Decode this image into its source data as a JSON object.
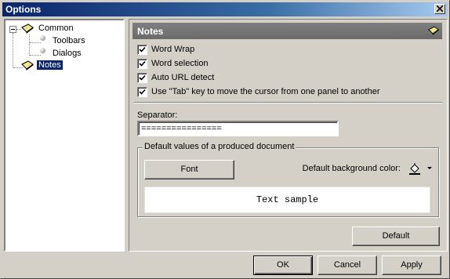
{
  "window": {
    "title": "Options"
  },
  "tree": {
    "items": [
      {
        "label": "Common"
      },
      {
        "label": "Toolbars"
      },
      {
        "label": "Dialogs"
      },
      {
        "label": "Notes",
        "selected": true
      }
    ]
  },
  "panel": {
    "title": "Notes",
    "options": [
      {
        "label": "Word Wrap",
        "checked": true
      },
      {
        "label": "Word selection",
        "checked": true
      },
      {
        "label": "Auto URL detect",
        "checked": true
      },
      {
        "label": "Use \"Tab\" key to move the cursor from one panel to another",
        "checked": true
      }
    ],
    "separator_label": "Separator:",
    "separator_value": "================",
    "group_title": "Default values of a produced document",
    "font_button": "Font",
    "bg_color_label": "Default background color:",
    "sample_text": "Text sample",
    "default_button": "Default"
  },
  "buttons": {
    "ok": "OK",
    "cancel": "Cancel",
    "apply": "Apply"
  },
  "colors": {
    "title_bar": "#0a246a",
    "selection": "#0a246a",
    "panel_header": "#808080",
    "dialog_bg": "#d4d0c8"
  }
}
